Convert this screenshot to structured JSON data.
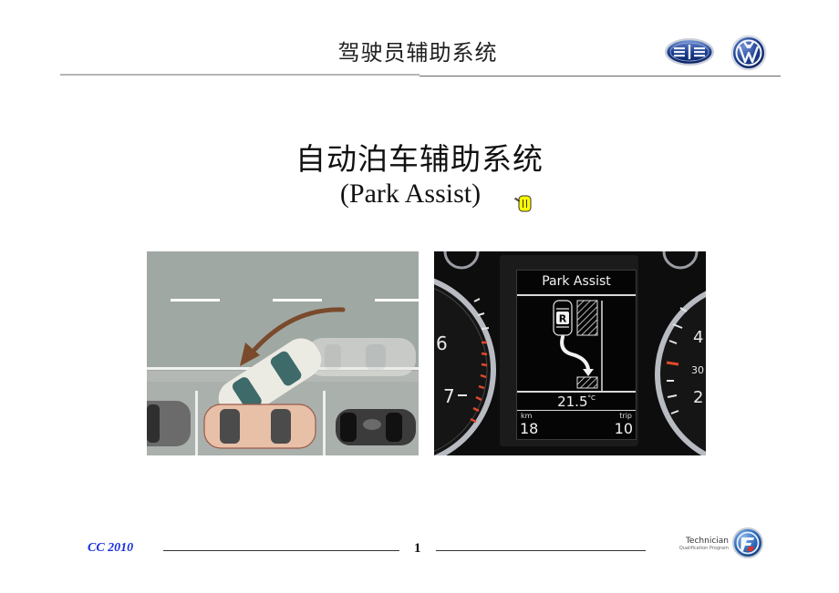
{
  "header": {
    "title": "驾驶员辅助系统",
    "logos": [
      "faw-logo",
      "vw-logo"
    ]
  },
  "slide": {
    "title": "自动泊车辅助系统",
    "subtitle": "(Park Assist)",
    "comment_icon": "comment-icon"
  },
  "images": {
    "parking_diagram": "car-parking-illustration",
    "instrument_cluster": {
      "display_title": "Park Assist",
      "gear": "R",
      "temperature": "21.5",
      "temperature_unit": "°C",
      "km_label": "km",
      "km_value": "18",
      "trip_label": "trip",
      "trip_value": "10",
      "left_gauge_numbers": [
        "6",
        "7"
      ],
      "right_gauge_numbers": [
        "4",
        "30",
        "2"
      ]
    }
  },
  "footer": {
    "left_text": "CC 2010",
    "page_number": "1",
    "program_line1": "Technician",
    "program_line2": "Qualification Program"
  },
  "colors": {
    "footer_accent": "#1a2fe0",
    "logo_blue": "#1d3f8f",
    "arrow_brown": "#7a4a2c"
  }
}
